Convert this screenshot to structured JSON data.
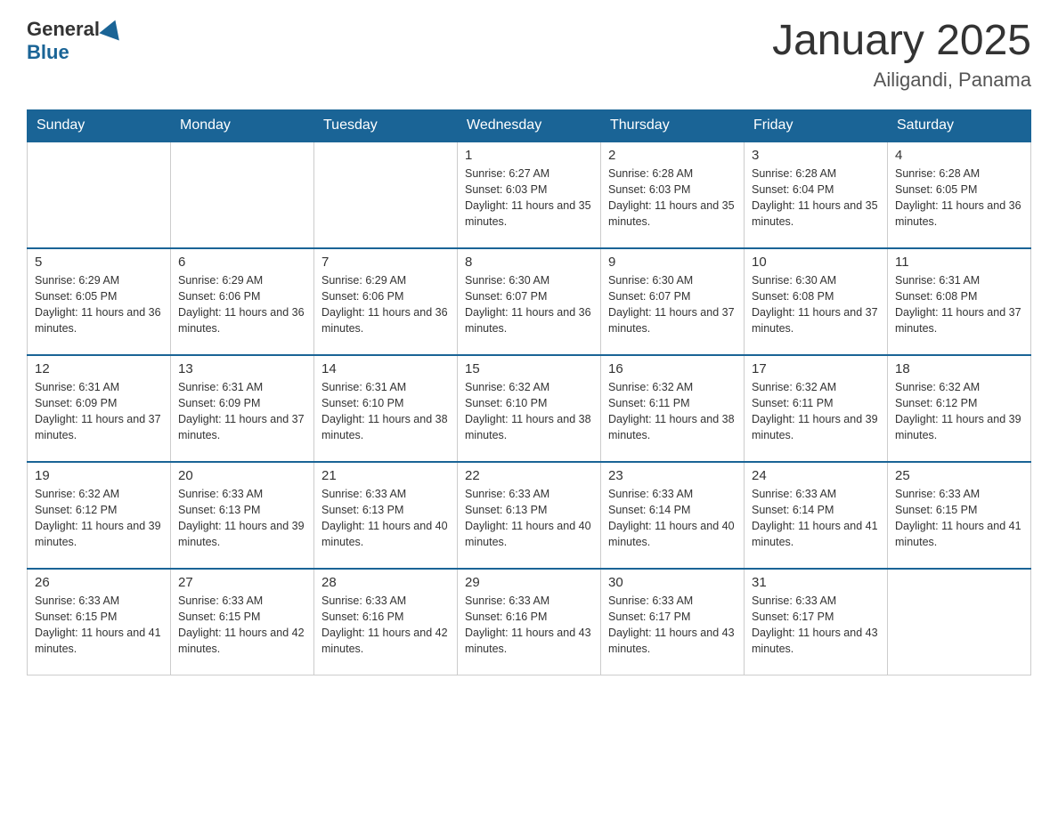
{
  "logo": {
    "general": "General",
    "blue": "Blue"
  },
  "header": {
    "title": "January 2025",
    "subtitle": "Ailigandi, Panama"
  },
  "days_of_week": [
    "Sunday",
    "Monday",
    "Tuesday",
    "Wednesday",
    "Thursday",
    "Friday",
    "Saturday"
  ],
  "weeks": [
    [
      null,
      null,
      null,
      {
        "day": 1,
        "sunrise": "Sunrise: 6:27 AM",
        "sunset": "Sunset: 6:03 PM",
        "daylight": "Daylight: 11 hours and 35 minutes."
      },
      {
        "day": 2,
        "sunrise": "Sunrise: 6:28 AM",
        "sunset": "Sunset: 6:03 PM",
        "daylight": "Daylight: 11 hours and 35 minutes."
      },
      {
        "day": 3,
        "sunrise": "Sunrise: 6:28 AM",
        "sunset": "Sunset: 6:04 PM",
        "daylight": "Daylight: 11 hours and 35 minutes."
      },
      {
        "day": 4,
        "sunrise": "Sunrise: 6:28 AM",
        "sunset": "Sunset: 6:05 PM",
        "daylight": "Daylight: 11 hours and 36 minutes."
      }
    ],
    [
      {
        "day": 5,
        "sunrise": "Sunrise: 6:29 AM",
        "sunset": "Sunset: 6:05 PM",
        "daylight": "Daylight: 11 hours and 36 minutes."
      },
      {
        "day": 6,
        "sunrise": "Sunrise: 6:29 AM",
        "sunset": "Sunset: 6:06 PM",
        "daylight": "Daylight: 11 hours and 36 minutes."
      },
      {
        "day": 7,
        "sunrise": "Sunrise: 6:29 AM",
        "sunset": "Sunset: 6:06 PM",
        "daylight": "Daylight: 11 hours and 36 minutes."
      },
      {
        "day": 8,
        "sunrise": "Sunrise: 6:30 AM",
        "sunset": "Sunset: 6:07 PM",
        "daylight": "Daylight: 11 hours and 36 minutes."
      },
      {
        "day": 9,
        "sunrise": "Sunrise: 6:30 AM",
        "sunset": "Sunset: 6:07 PM",
        "daylight": "Daylight: 11 hours and 37 minutes."
      },
      {
        "day": 10,
        "sunrise": "Sunrise: 6:30 AM",
        "sunset": "Sunset: 6:08 PM",
        "daylight": "Daylight: 11 hours and 37 minutes."
      },
      {
        "day": 11,
        "sunrise": "Sunrise: 6:31 AM",
        "sunset": "Sunset: 6:08 PM",
        "daylight": "Daylight: 11 hours and 37 minutes."
      }
    ],
    [
      {
        "day": 12,
        "sunrise": "Sunrise: 6:31 AM",
        "sunset": "Sunset: 6:09 PM",
        "daylight": "Daylight: 11 hours and 37 minutes."
      },
      {
        "day": 13,
        "sunrise": "Sunrise: 6:31 AM",
        "sunset": "Sunset: 6:09 PM",
        "daylight": "Daylight: 11 hours and 37 minutes."
      },
      {
        "day": 14,
        "sunrise": "Sunrise: 6:31 AM",
        "sunset": "Sunset: 6:10 PM",
        "daylight": "Daylight: 11 hours and 38 minutes."
      },
      {
        "day": 15,
        "sunrise": "Sunrise: 6:32 AM",
        "sunset": "Sunset: 6:10 PM",
        "daylight": "Daylight: 11 hours and 38 minutes."
      },
      {
        "day": 16,
        "sunrise": "Sunrise: 6:32 AM",
        "sunset": "Sunset: 6:11 PM",
        "daylight": "Daylight: 11 hours and 38 minutes."
      },
      {
        "day": 17,
        "sunrise": "Sunrise: 6:32 AM",
        "sunset": "Sunset: 6:11 PM",
        "daylight": "Daylight: 11 hours and 39 minutes."
      },
      {
        "day": 18,
        "sunrise": "Sunrise: 6:32 AM",
        "sunset": "Sunset: 6:12 PM",
        "daylight": "Daylight: 11 hours and 39 minutes."
      }
    ],
    [
      {
        "day": 19,
        "sunrise": "Sunrise: 6:32 AM",
        "sunset": "Sunset: 6:12 PM",
        "daylight": "Daylight: 11 hours and 39 minutes."
      },
      {
        "day": 20,
        "sunrise": "Sunrise: 6:33 AM",
        "sunset": "Sunset: 6:13 PM",
        "daylight": "Daylight: 11 hours and 39 minutes."
      },
      {
        "day": 21,
        "sunrise": "Sunrise: 6:33 AM",
        "sunset": "Sunset: 6:13 PM",
        "daylight": "Daylight: 11 hours and 40 minutes."
      },
      {
        "day": 22,
        "sunrise": "Sunrise: 6:33 AM",
        "sunset": "Sunset: 6:13 PM",
        "daylight": "Daylight: 11 hours and 40 minutes."
      },
      {
        "day": 23,
        "sunrise": "Sunrise: 6:33 AM",
        "sunset": "Sunset: 6:14 PM",
        "daylight": "Daylight: 11 hours and 40 minutes."
      },
      {
        "day": 24,
        "sunrise": "Sunrise: 6:33 AM",
        "sunset": "Sunset: 6:14 PM",
        "daylight": "Daylight: 11 hours and 41 minutes."
      },
      {
        "day": 25,
        "sunrise": "Sunrise: 6:33 AM",
        "sunset": "Sunset: 6:15 PM",
        "daylight": "Daylight: 11 hours and 41 minutes."
      }
    ],
    [
      {
        "day": 26,
        "sunrise": "Sunrise: 6:33 AM",
        "sunset": "Sunset: 6:15 PM",
        "daylight": "Daylight: 11 hours and 41 minutes."
      },
      {
        "day": 27,
        "sunrise": "Sunrise: 6:33 AM",
        "sunset": "Sunset: 6:15 PM",
        "daylight": "Daylight: 11 hours and 42 minutes."
      },
      {
        "day": 28,
        "sunrise": "Sunrise: 6:33 AM",
        "sunset": "Sunset: 6:16 PM",
        "daylight": "Daylight: 11 hours and 42 minutes."
      },
      {
        "day": 29,
        "sunrise": "Sunrise: 6:33 AM",
        "sunset": "Sunset: 6:16 PM",
        "daylight": "Daylight: 11 hours and 43 minutes."
      },
      {
        "day": 30,
        "sunrise": "Sunrise: 6:33 AM",
        "sunset": "Sunset: 6:17 PM",
        "daylight": "Daylight: 11 hours and 43 minutes."
      },
      {
        "day": 31,
        "sunrise": "Sunrise: 6:33 AM",
        "sunset": "Sunset: 6:17 PM",
        "daylight": "Daylight: 11 hours and 43 minutes."
      },
      null
    ]
  ]
}
